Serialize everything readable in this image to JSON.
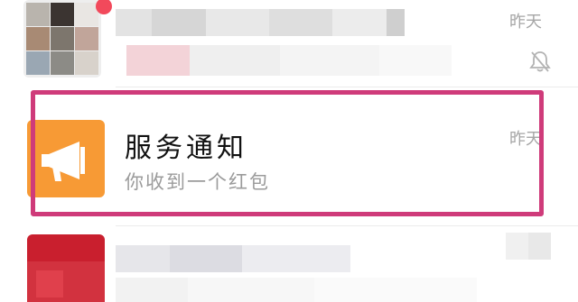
{
  "chat_list": {
    "rows": [
      {
        "kind": "group-chat",
        "time": "昨天",
        "unread_dot": true,
        "muted": true,
        "icon": "bell-muted-icon"
      },
      {
        "kind": "service-notification",
        "title": "服务通知",
        "preview": "你收到一个红包",
        "time": "昨天",
        "icon": "megaphone-icon",
        "avatar_color": "#f79a35",
        "highlight_color": "#cf3b7a"
      },
      {
        "kind": "contact",
        "time": ""
      }
    ]
  }
}
